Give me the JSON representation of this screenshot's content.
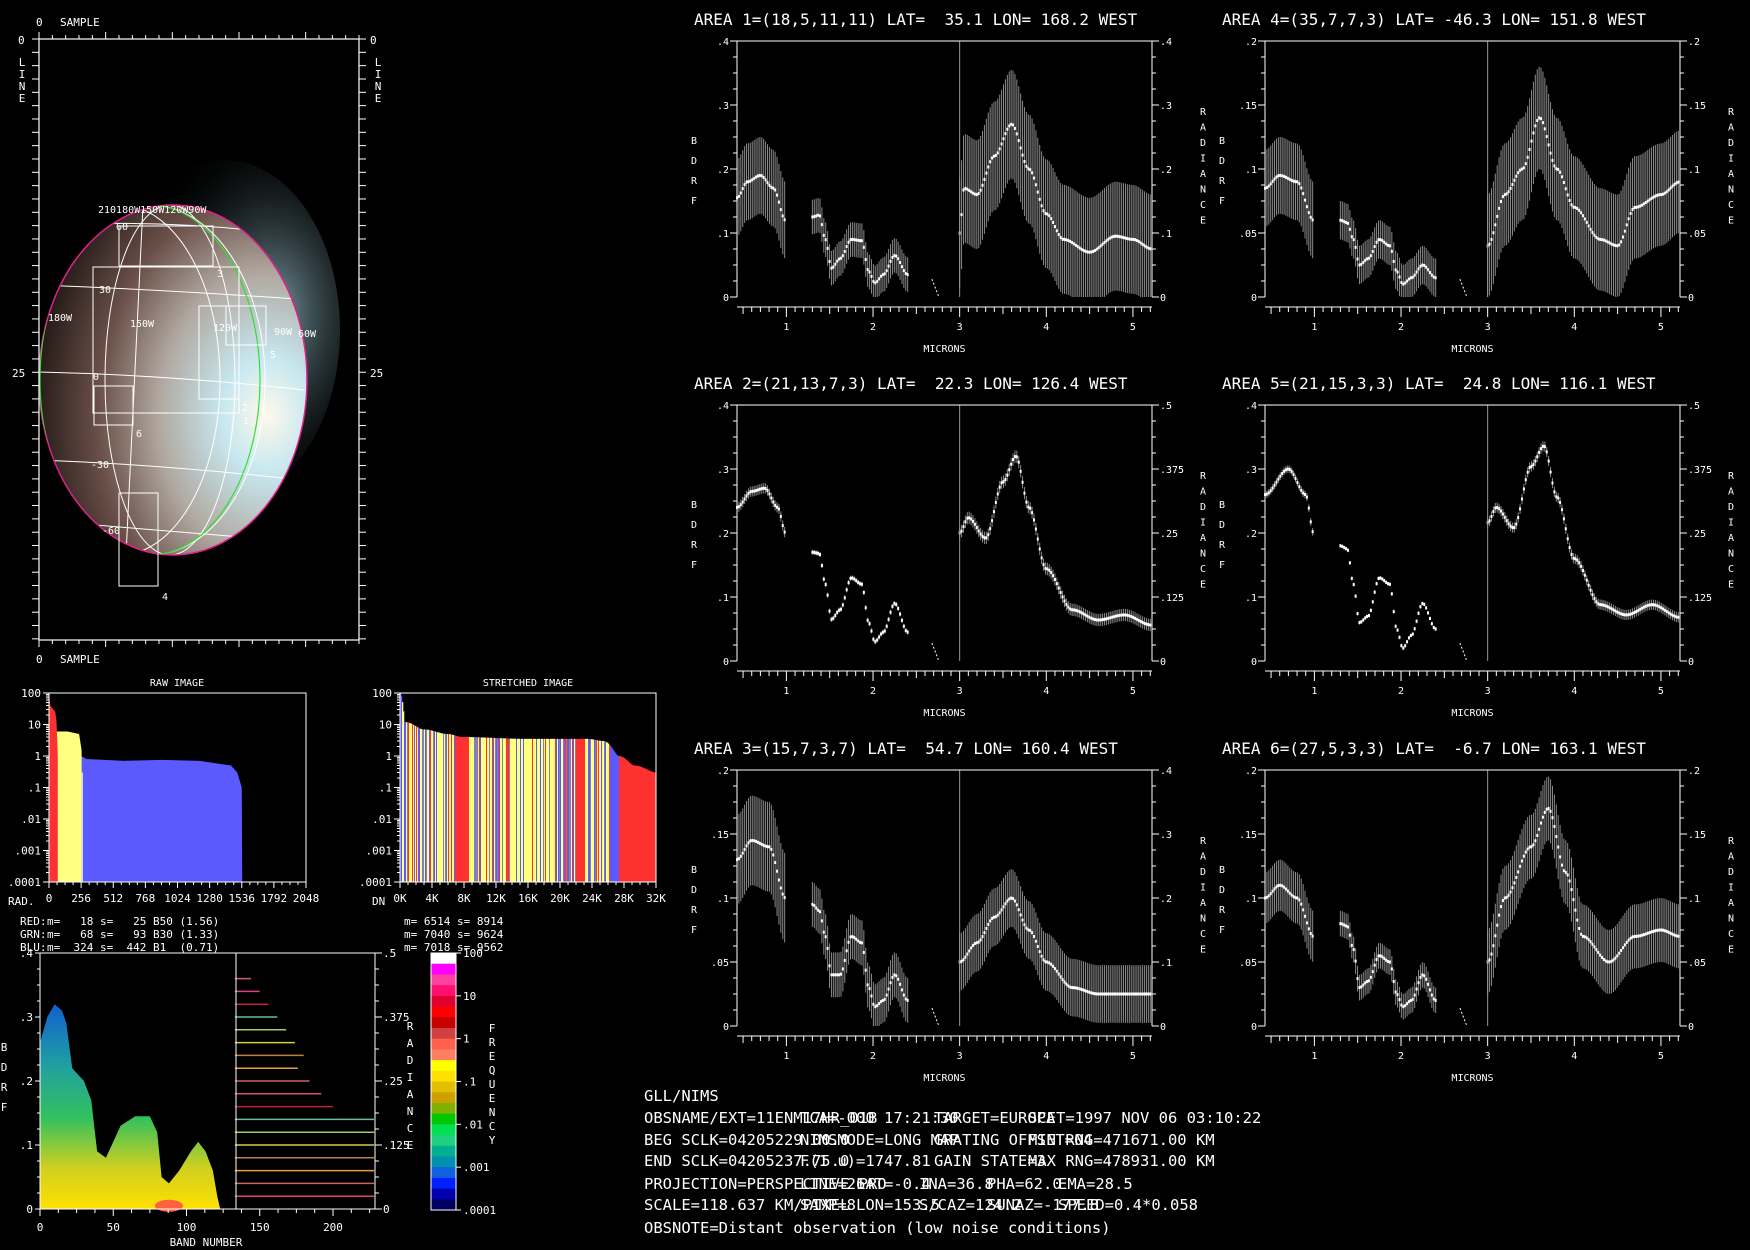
{
  "image_panel": {
    "top_origin": "0",
    "top_axis": "SAMPLE",
    "bottom_origin": "0",
    "bottom_axis": "SAMPLE",
    "left_origin": "0",
    "right_origin": "0",
    "left_mid": "25",
    "right_mid": "25",
    "line_label": [
      "L",
      "I",
      "N",
      "E"
    ],
    "lon_labels_top": "210180W150W120W90W",
    "lon_labels": [
      "180W",
      "150W",
      "120W",
      "90W",
      "60W"
    ],
    "lat_labels": [
      "60",
      "30",
      "0",
      "-30",
      "-60"
    ],
    "area_labels": [
      "1",
      "2",
      "3",
      "4",
      "5",
      "6"
    ]
  },
  "histograms": {
    "raw": {
      "title": "RAW IMAGE",
      "xprefix": "RAD.",
      "yticks": [
        "100",
        "10",
        "1",
        ".1",
        ".01",
        ".001",
        ".0001"
      ],
      "xticks": [
        "0",
        "256",
        "512",
        "768",
        "1024",
        "1280",
        "1536",
        "1792",
        "2048"
      ],
      "stats": [
        {
          "ch": "RED:",
          "text": "m=   18 s=   25 B50 (1.56)",
          "color": "#ff3030"
        },
        {
          "ch": "GRN:",
          "text": "m=   68 s=   93 B30 (1.33)",
          "color": "#ffff80"
        },
        {
          "ch": "BLU:",
          "text": "m=  324 s=  442 B1  (0.71)",
          "color": "#5a5aff"
        }
      ]
    },
    "stretched": {
      "title": "STRETCHED IMAGE",
      "xprefix": "DN",
      "yticks": [
        "100",
        "10",
        "1",
        ".1",
        ".01",
        ".001",
        ".0001"
      ],
      "xticks": [
        "0K",
        "4K",
        "8K",
        "12K",
        "16K",
        "20K",
        "24K",
        "28K",
        "32K"
      ],
      "stats": [
        "m= 6514 s= 8914",
        "m= 7040 s= 9624",
        "m= 7018 s= 9562"
      ]
    }
  },
  "density_plot": {
    "ylabel": [
      "B",
      "D",
      "R",
      "F"
    ],
    "rlabel": [
      "R",
      "A",
      "D",
      "I",
      "A",
      "N",
      "C",
      "E"
    ],
    "xlabel": "BAND NUMBER",
    "yticks": [
      ".4",
      ".3",
      ".2",
      ".1",
      "0"
    ],
    "rticks": [
      ".5",
      ".375",
      ".25",
      ".125",
      "0"
    ],
    "xticks": [
      "0",
      "50",
      "100",
      "150",
      "200"
    ],
    "colorbar_ticks": [
      "100",
      "10",
      "1",
      ".1",
      ".01",
      ".001",
      ".0001"
    ],
    "colorbar_label": [
      "F",
      "R",
      "E",
      "Q",
      "U",
      "E",
      "N",
      "C",
      "Y"
    ],
    "colorbar_colors": [
      "#ffffff",
      "#ff00ff",
      "#ff40a0",
      "#ff1070",
      "#e00030",
      "#ff0000",
      "#c80000",
      "#d04040",
      "#ff6050",
      "#ff8060",
      "#ffff00",
      "#ffe000",
      "#e0c000",
      "#d0a000",
      "#80b000",
      "#00c800",
      "#00e050",
      "#20d080",
      "#00b090",
      "#0090b0",
      "#1060e0",
      "#0020ff",
      "#0000b0",
      "#000060"
    ]
  },
  "spectra": {
    "xlabel": "MICRONS",
    "ylabel": [
      "B",
      "D",
      "R",
      "F"
    ],
    "rlabel": [
      "R",
      "A",
      "D",
      "I",
      "A",
      "N",
      "C",
      "E"
    ],
    "xticks": [
      "1",
      "2",
      "3",
      "4",
      "5"
    ]
  },
  "chart_data": [
    {
      "type": "line",
      "title": "AREA 1=(18,5,11,11) LAT=  35.1 LON= 168.2 WEST",
      "xlim": [
        0.43,
        5.22
      ],
      "ylim_left": [
        0,
        0.4
      ],
      "ylim_right": [
        0,
        0.4
      ],
      "yticks_left": [
        "0",
        ".1",
        ".2",
        ".3",
        ".4"
      ],
      "yticks_right": [
        "0",
        ".1",
        ".2",
        ".3",
        ".4"
      ],
      "err_left": 0.06,
      "err_right": 0.085,
      "bdrf": [
        [
          [
            0.43,
            0.155
          ],
          [
            0.55,
            0.18
          ],
          [
            0.7,
            0.19
          ],
          [
            0.85,
            0.17
          ],
          [
            0.99,
            0.12
          ]
        ],
        [
          [
            1.3,
            0.125
          ],
          [
            1.38,
            0.128
          ],
          [
            1.45,
            0.09
          ],
          [
            1.52,
            0.045
          ],
          [
            1.62,
            0.06
          ],
          [
            1.75,
            0.09
          ],
          [
            1.87,
            0.088
          ],
          [
            1.95,
            0.04
          ],
          [
            2.02,
            0.022
          ],
          [
            2.12,
            0.035
          ],
          [
            2.25,
            0.065
          ],
          [
            2.4,
            0.035
          ]
        ]
      ],
      "radiance": [
        [
          3.0,
          0.1
        ],
        [
          3.05,
          0.17
        ],
        [
          3.2,
          0.16
        ],
        [
          3.4,
          0.22
        ],
        [
          3.6,
          0.27
        ],
        [
          3.8,
          0.2
        ],
        [
          4.0,
          0.13
        ],
        [
          4.2,
          0.09
        ],
        [
          4.5,
          0.07
        ],
        [
          4.8,
          0.095
        ],
        [
          5.0,
          0.09
        ],
        [
          5.22,
          0.075
        ]
      ]
    },
    {
      "type": "line",
      "title": "AREA 2=(21,13,7,3) LAT=  22.3 LON= 126.4 WEST",
      "xlim": [
        0.43,
        5.22
      ],
      "ylim_left": [
        0,
        0.4
      ],
      "ylim_right": [
        0,
        0.5
      ],
      "yticks_left": [
        "0",
        ".1",
        ".2",
        ".3",
        ".4"
      ],
      "yticks_right": [
        "0",
        ".125",
        ".25",
        ".375",
        ".5"
      ],
      "err_left": 0.008,
      "err_right": 0.012,
      "bdrf": [
        [
          [
            0.43,
            0.24
          ],
          [
            0.6,
            0.265
          ],
          [
            0.75,
            0.27
          ],
          [
            0.9,
            0.24
          ],
          [
            0.99,
            0.2
          ]
        ],
        [
          [
            1.3,
            0.17
          ],
          [
            1.38,
            0.168
          ],
          [
            1.45,
            0.12
          ],
          [
            1.52,
            0.065
          ],
          [
            1.62,
            0.08
          ],
          [
            1.75,
            0.13
          ],
          [
            1.87,
            0.12
          ],
          [
            1.95,
            0.06
          ],
          [
            2.02,
            0.03
          ],
          [
            2.12,
            0.045
          ],
          [
            2.25,
            0.09
          ],
          [
            2.4,
            0.045
          ]
        ]
      ],
      "radiance": [
        [
          3.0,
          0.25
        ],
        [
          3.1,
          0.28
        ],
        [
          3.3,
          0.24
        ],
        [
          3.5,
          0.35
        ],
        [
          3.65,
          0.4
        ],
        [
          3.8,
          0.3
        ],
        [
          4.0,
          0.18
        ],
        [
          4.3,
          0.1
        ],
        [
          4.6,
          0.08
        ],
        [
          4.9,
          0.09
        ],
        [
          5.22,
          0.07
        ]
      ]
    },
    {
      "type": "line",
      "title": "AREA 3=(15,7,3,7) LAT=  54.7 LON= 160.4 WEST",
      "xlim": [
        0.43,
        5.22
      ],
      "ylim_left": [
        0,
        0.2
      ],
      "ylim_right": [
        0,
        0.4
      ],
      "yticks_left": [
        "0",
        ".05",
        ".1",
        ".15",
        ".2"
      ],
      "yticks_right": [
        "0",
        ".1",
        ".2",
        ".3",
        ".4"
      ],
      "err_left": 0.035,
      "err_right": 0.045,
      "bdrf": [
        [
          [
            0.43,
            0.13
          ],
          [
            0.6,
            0.145
          ],
          [
            0.8,
            0.14
          ],
          [
            0.99,
            0.1
          ]
        ],
        [
          [
            1.3,
            0.095
          ],
          [
            1.38,
            0.09
          ],
          [
            1.45,
            0.07
          ],
          [
            1.52,
            0.04
          ],
          [
            1.62,
            0.04
          ],
          [
            1.75,
            0.07
          ],
          [
            1.87,
            0.065
          ],
          [
            1.95,
            0.03
          ],
          [
            2.02,
            0.015
          ],
          [
            2.12,
            0.02
          ],
          [
            2.25,
            0.04
          ],
          [
            2.4,
            0.02
          ]
        ]
      ],
      "radiance": [
        [
          3.0,
          0.1
        ],
        [
          3.2,
          0.13
        ],
        [
          3.4,
          0.17
        ],
        [
          3.6,
          0.2
        ],
        [
          3.8,
          0.15
        ],
        [
          4.0,
          0.1
        ],
        [
          4.3,
          0.06
        ],
        [
          4.6,
          0.05
        ],
        [
          5.22,
          0.05
        ]
      ]
    },
    {
      "type": "line",
      "title": "AREA 4=(35,7,7,3) LAT= -46.3 LON= 151.8 WEST",
      "xlim": [
        0.43,
        5.22
      ],
      "ylim_left": [
        0,
        0.2
      ],
      "ylim_right": [
        0,
        0.2
      ],
      "yticks_left": [
        "0",
        ".05",
        ".1",
        ".15",
        ".2"
      ],
      "yticks_right": [
        "0",
        ".05",
        ".1",
        ".15",
        ".2"
      ],
      "err_left": 0.03,
      "err_right": 0.04,
      "bdrf": [
        [
          [
            0.43,
            0.085
          ],
          [
            0.6,
            0.095
          ],
          [
            0.8,
            0.09
          ],
          [
            0.99,
            0.06
          ]
        ],
        [
          [
            1.3,
            0.06
          ],
          [
            1.38,
            0.058
          ],
          [
            1.45,
            0.045
          ],
          [
            1.52,
            0.025
          ],
          [
            1.62,
            0.03
          ],
          [
            1.75,
            0.045
          ],
          [
            1.87,
            0.04
          ],
          [
            1.95,
            0.02
          ],
          [
            2.02,
            0.01
          ],
          [
            2.12,
            0.015
          ],
          [
            2.25,
            0.025
          ],
          [
            2.4,
            0.015
          ]
        ]
      ],
      "radiance": [
        [
          3.0,
          0.04
        ],
        [
          3.2,
          0.08
        ],
        [
          3.4,
          0.1
        ],
        [
          3.6,
          0.14
        ],
        [
          3.8,
          0.1
        ],
        [
          4.0,
          0.07
        ],
        [
          4.3,
          0.045
        ],
        [
          4.5,
          0.04
        ],
        [
          4.7,
          0.07
        ],
        [
          5.0,
          0.08
        ],
        [
          5.22,
          0.09
        ]
      ]
    },
    {
      "type": "line",
      "title": "AREA 5=(21,15,3,3) LAT=  24.8 LON= 116.1 WEST",
      "xlim": [
        0.43,
        5.22
      ],
      "ylim_left": [
        0,
        0.4
      ],
      "ylim_right": [
        0,
        0.5
      ],
      "yticks_left": [
        "0",
        ".1",
        ".2",
        ".3",
        ".4"
      ],
      "yticks_right": [
        "0",
        ".125",
        ".25",
        ".375",
        ".5"
      ],
      "err_left": 0.006,
      "err_right": 0.01,
      "bdrf": [
        [
          [
            0.43,
            0.26
          ],
          [
            0.7,
            0.3
          ],
          [
            0.9,
            0.26
          ],
          [
            0.99,
            0.2
          ]
        ],
        [
          [
            1.3,
            0.18
          ],
          [
            1.38,
            0.175
          ],
          [
            1.45,
            0.12
          ],
          [
            1.52,
            0.06
          ],
          [
            1.62,
            0.07
          ],
          [
            1.75,
            0.13
          ],
          [
            1.87,
            0.12
          ],
          [
            1.95,
            0.05
          ],
          [
            2.02,
            0.02
          ],
          [
            2.12,
            0.04
          ],
          [
            2.25,
            0.09
          ],
          [
            2.4,
            0.05
          ]
        ]
      ],
      "radiance": [
        [
          3.0,
          0.27
        ],
        [
          3.1,
          0.3
        ],
        [
          3.3,
          0.26
        ],
        [
          3.5,
          0.38
        ],
        [
          3.65,
          0.42
        ],
        [
          3.8,
          0.32
        ],
        [
          4.0,
          0.2
        ],
        [
          4.3,
          0.11
        ],
        [
          4.6,
          0.09
        ],
        [
          4.9,
          0.11
        ],
        [
          5.22,
          0.085
        ]
      ]
    },
    {
      "type": "line",
      "title": "AREA 6=(27,5,3,3) LAT=  -6.7 LON= 163.1 WEST",
      "xlim": [
        0.43,
        5.22
      ],
      "ylim_left": [
        0,
        0.2
      ],
      "ylim_right": [
        0,
        0.2
      ],
      "yticks_left": [
        "0",
        ".05",
        ".1",
        ".15",
        ".2"
      ],
      "yticks_right": [
        "0",
        ".05",
        ".1",
        ".15",
        ".2"
      ],
      "err_left": 0.02,
      "err_right": 0.025,
      "bdrf": [
        [
          [
            0.43,
            0.1
          ],
          [
            0.6,
            0.11
          ],
          [
            0.8,
            0.1
          ],
          [
            0.99,
            0.07
          ]
        ],
        [
          [
            1.3,
            0.08
          ],
          [
            1.38,
            0.078
          ],
          [
            1.45,
            0.06
          ],
          [
            1.52,
            0.03
          ],
          [
            1.62,
            0.035
          ],
          [
            1.75,
            0.055
          ],
          [
            1.87,
            0.05
          ],
          [
            1.95,
            0.025
          ],
          [
            2.02,
            0.015
          ],
          [
            2.12,
            0.02
          ],
          [
            2.25,
            0.04
          ],
          [
            2.4,
            0.02
          ]
        ]
      ],
      "radiance": [
        [
          3.0,
          0.05
        ],
        [
          3.2,
          0.1
        ],
        [
          3.5,
          0.14
        ],
        [
          3.7,
          0.17
        ],
        [
          3.9,
          0.12
        ],
        [
          4.1,
          0.07
        ],
        [
          4.4,
          0.05
        ],
        [
          4.7,
          0.07
        ],
        [
          5.0,
          0.075
        ],
        [
          5.22,
          0.07
        ]
      ]
    },
    {
      "type": "area",
      "title": "RAW IMAGE",
      "yscale": "log",
      "ylim": [
        0.0001,
        100
      ],
      "xlim": [
        0,
        2048
      ],
      "series": [
        {
          "name": "BLU",
          "color": "#5a5aff",
          "points": [
            [
              0,
              50
            ],
            [
              10,
              4
            ],
            [
              40,
              1.5
            ],
            [
              200,
              1.2
            ],
            [
              256,
              1.0
            ],
            [
              300,
              0.8
            ],
            [
              600,
              0.7
            ],
            [
              900,
              0.75
            ],
            [
              1200,
              0.7
            ],
            [
              1450,
              0.5
            ],
            [
              1500,
              0.3
            ],
            [
              1536,
              0.1
            ],
            [
              1540,
              0.0001
            ]
          ]
        },
        {
          "name": "GRN",
          "color": "#ffff80",
          "points": [
            [
              0,
              80
            ],
            [
              15,
              12
            ],
            [
              40,
              6
            ],
            [
              150,
              6
            ],
            [
              240,
              5
            ],
            [
              260,
              1.5
            ]
          ]
        },
        {
          "name": "RED",
          "color": "#ff3030",
          "points": [
            [
              0,
              100
            ],
            [
              10,
              40
            ],
            [
              50,
              25
            ],
            [
              60,
              12
            ],
            [
              70,
              1
            ]
          ]
        }
      ]
    },
    {
      "type": "area",
      "title": "STRETCHED IMAGE",
      "yscale": "log",
      "ylim": [
        0.0001,
        100
      ],
      "xlim": [
        0,
        32768
      ],
      "envelope": [
        [
          0,
          100
        ],
        [
          600,
          12
        ],
        [
          3000,
          7
        ],
        [
          6000,
          5
        ],
        [
          8000,
          4
        ],
        [
          16000,
          3.5
        ],
        [
          24000,
          3.5
        ],
        [
          26000,
          3
        ],
        [
          28000,
          1
        ],
        [
          30000,
          0.5
        ],
        [
          32768,
          0.3
        ]
      ]
    }
  ]
}
